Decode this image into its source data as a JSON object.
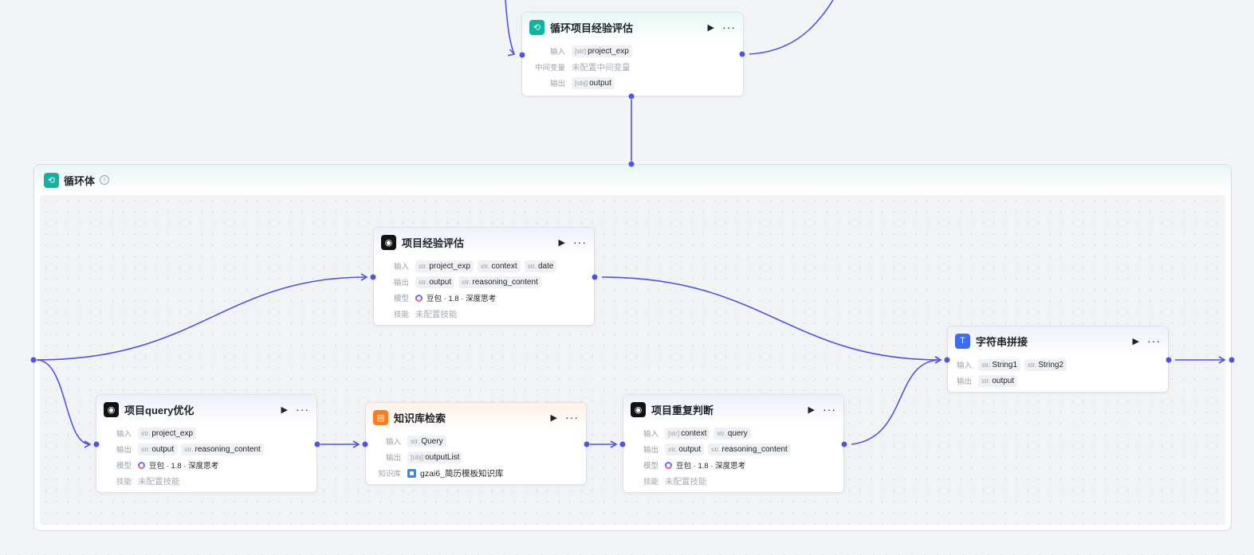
{
  "colors": {
    "edge": "#4e55e6",
    "teal": "#10b3a0",
    "orange": "#fa7d1d",
    "blue": "#3b6cf6"
  },
  "loop_node": {
    "title": "循环项目经验评估",
    "icon": "loop-icon",
    "input_label": "输入",
    "input_type": "[str]",
    "input_value": "project_exp",
    "mid_label": "中间变量",
    "mid_value": "未配置中间变量",
    "output_label": "输出",
    "output_type": "[obj]",
    "output_value": "output"
  },
  "loop_body": {
    "title": "循环体",
    "icon": "loop-icon"
  },
  "nodes": {
    "eval": {
      "title": "项目经验评估",
      "icon": "llm-icon",
      "input_label": "输入",
      "inputs": [
        {
          "t": "str.",
          "v": "project_exp"
        },
        {
          "t": "str.",
          "v": "context"
        },
        {
          "t": "str.",
          "v": "date"
        }
      ],
      "output_label": "输出",
      "outputs": [
        {
          "t": "str.",
          "v": "output"
        },
        {
          "t": "str.",
          "v": "reasoning_content"
        }
      ],
      "model_label": "模型",
      "model": "豆包 · 1.8 · 深度思考",
      "skill_label": "技能",
      "skill": "未配置技能"
    },
    "query": {
      "title": "项目query优化",
      "icon": "llm-icon",
      "input_label": "输入",
      "inputs": [
        {
          "t": "str.",
          "v": "project_exp"
        }
      ],
      "output_label": "输出",
      "outputs": [
        {
          "t": "str.",
          "v": "output"
        },
        {
          "t": "str.",
          "v": "reasoning_content"
        }
      ],
      "model_label": "模型",
      "model": "豆包 · 1.8 · 深度思考",
      "skill_label": "技能",
      "skill": "未配置技能"
    },
    "kb": {
      "title": "知识库检索",
      "icon": "knowledge-icon",
      "input_label": "输入",
      "inputs": [
        {
          "t": "str.",
          "v": "Query"
        }
      ],
      "output_label": "输出",
      "outputs": [
        {
          "t": "[obj]",
          "v": "outputList"
        }
      ],
      "kb_label": "知识库",
      "kb": "gzai6_简历模板知识库"
    },
    "dup": {
      "title": "项目重复判断",
      "icon": "llm-icon",
      "input_label": "输入",
      "inputs": [
        {
          "t": "[str]",
          "v": "context"
        },
        {
          "t": "str.",
          "v": "query"
        }
      ],
      "output_label": "输出",
      "outputs": [
        {
          "t": "str.",
          "v": "output"
        },
        {
          "t": "str.",
          "v": "reasoning_content"
        }
      ],
      "model_label": "模型",
      "model": "豆包 · 1.8 · 深度思考",
      "skill_label": "技能",
      "skill": "未配置技能"
    },
    "concat": {
      "title": "字符串拼接",
      "icon": "text-icon",
      "input_label": "输入",
      "inputs": [
        {
          "t": "str.",
          "v": "String1"
        },
        {
          "t": "str.",
          "v": "String2"
        }
      ],
      "output_label": "输出",
      "outputs": [
        {
          "t": "str.",
          "v": "output"
        }
      ]
    }
  }
}
